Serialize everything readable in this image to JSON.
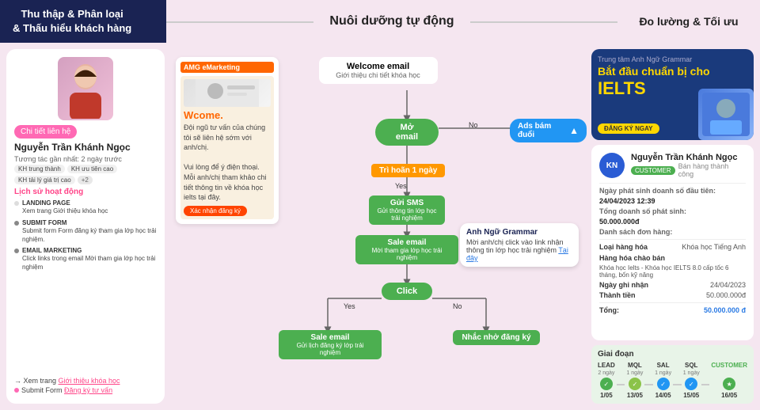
{
  "header": {
    "left_label": "Thu thập & Phân loại\n& Thấu hiểu khách hàng",
    "center_label": "Nuôi dưỡng tự động",
    "right_label": "Đo lường & Tối ưu"
  },
  "left_panel": {
    "contact_badge": "Chi tiết liên hệ",
    "person_name": "Nguyễn Trần Khánh Ngọc",
    "person_desc": "Tương tác gần nhất: 2 ngày trước",
    "tags": [
      "KH trung thành",
      "KH ưu tiên cao",
      "KH tải lý giá trị cao"
    ],
    "tag_plus": "+2",
    "activity_title": "Lịch sử hoạt động",
    "activities": [
      {
        "label": "LANDING PAGE",
        "desc": "Xem trang Giới thiệu khóa học"
      },
      {
        "label": "SUBMIT FORM",
        "desc": "Submit form Form đăng ký tham gia lớp học trải nghiệm."
      },
      {
        "label": "EMAIL MARKETING",
        "desc": "Click links trong email Mời tham gia lớp học trải nghiệm"
      }
    ],
    "bottom_links": [
      "Xem trang Giới thiệu khóa học",
      "Submit Form Đăng ký tư vấn"
    ]
  },
  "email_preview": {
    "header_text": "AMG eMarketing",
    "welcome_text": "Wcome.",
    "body_text": "Đội ngũ tư vấn của chúng tôi sẽ liên hệ sớm với anh/chị.\n\nVui lòng để ý điện thoại. Mỗi anh/chị tham khảo chi tiết thông tin về khóa học ielts tại đây.",
    "btn_label": "Xác nhận đăng ký"
  },
  "flowchart": {
    "welcome_email_title": "Welcome email",
    "welcome_email_sub": "Giới thiệu chi tiết khóa học",
    "mo_email_label": "Mở email",
    "tri_hoan_label": "Trì hoãn 1 ngày",
    "no_label_1": "No",
    "yes_label_1": "Yes",
    "ads_label": "Ads bám đuổi",
    "gui_sms_title": "Gửi SMS",
    "gui_sms_sub": "Gửi thông tin lớp học trải nghiệm",
    "sale_email_title": "Sale email",
    "sale_email_sub": "Mời tham gia lớp học trải nghiệm",
    "click_label": "Click",
    "yes_label_2": "Yes",
    "no_label_2": "No",
    "sale_email_2_title": "Sale email",
    "sale_email_2_sub": "Gửi lịch đăng ký lớp trải nghiệm",
    "nhac_nho_title": "Nhắc nhở đăng ký"
  },
  "ads_card": {
    "header_text": "Trung tâm Anh Ngữ Grammar",
    "title_line1": "Bắt đầu chuẩn bị cho",
    "title_highlight": "IELTS",
    "btn_label": "ĐĂNG KÝ NGAY"
  },
  "customer_card": {
    "avatar_initials": "KN",
    "name": "Nguyễn Trần Khánh Ngọc",
    "badge": "CUSTOMER",
    "role": "Bán hàng thành công",
    "date_label": "Ngày phát sinh doanh số đầu tiên:",
    "date_value": "24/04/2023  12:39",
    "total_label": "Tổng doanh số phát sinh:",
    "total_value": "50.000.000đ",
    "orders_label": "Danh sách đơn hàng:",
    "product_type_label": "Loại hàng hóa",
    "product_type_value": "Khóa học Tiếng Anh",
    "promo_label": "Hàng hóa chào bán",
    "promo_value": "Khóa học Ielts - Khóa học IELTS 8.0 cấp tốc 6 tháng, bốn kỹ năng",
    "date_ghi_nhan_label": "Ngày ghi nhận",
    "date_ghi_nhan_value": "24/04/2023",
    "thanh_tien_label": "Thành tiền",
    "thanh_tien_value": "50.000.000đ",
    "total_row_label": "Tổng:",
    "total_row_value": "50.000.000 đ"
  },
  "giai_doan": {
    "title": "Giai đoạn",
    "stages": [
      {
        "name": "LEAD",
        "days": "2 ngày",
        "color": "#4CAF50",
        "date": "1/05"
      },
      {
        "name": "MQL",
        "days": "1 ngày",
        "color": "#8BC34A",
        "date": "13/05"
      },
      {
        "name": "SAL",
        "days": "1 ngày",
        "color": "#2196F3",
        "date": "14/05"
      },
      {
        "name": "SQL",
        "days": "1 ngày",
        "color": "#2196F3",
        "date": "15/05"
      },
      {
        "name": "CUSTOMER",
        "days": "",
        "color": "#4CAF50",
        "date": "16/05"
      }
    ]
  },
  "chat_bubble": {
    "header": "Anh Ngữ Grammar",
    "body": "Mời anh/chị click vào link nhận thông tin lớp học trải nghiệm",
    "link_text": "Tại đây"
  }
}
